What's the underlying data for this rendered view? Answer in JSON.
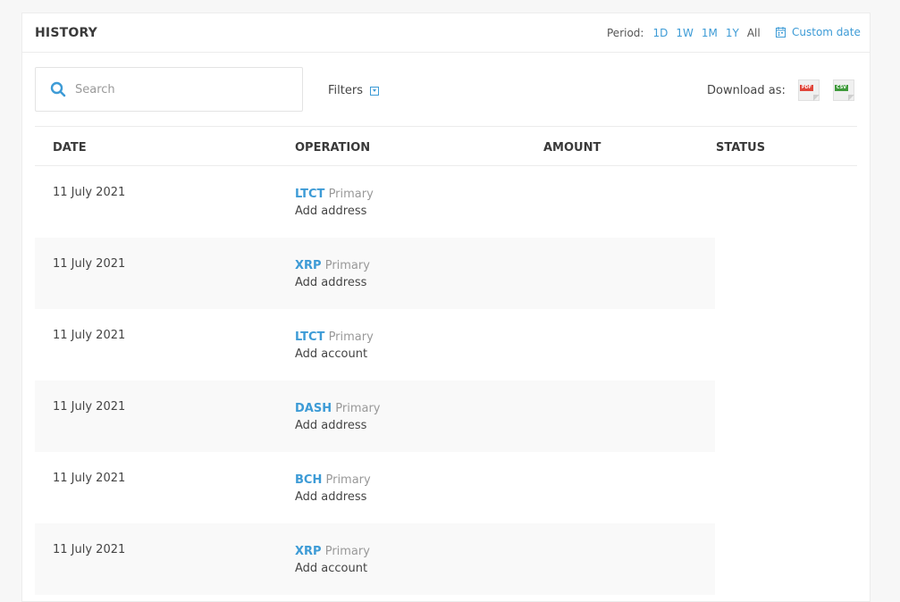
{
  "header": {
    "title": "HISTORY",
    "period_label": "Period:",
    "period_options": [
      "1D",
      "1W",
      "1M",
      "1Y",
      "All"
    ],
    "period_selected": "All",
    "custom_date": "Custom date"
  },
  "toolbar": {
    "search_placeholder": "Search",
    "filters_label": "Filters",
    "download_label": "Download as:",
    "formats": [
      "PDF",
      "CSV"
    ]
  },
  "table": {
    "columns": [
      "DATE",
      "OPERATION",
      "AMOUNT",
      "STATUS"
    ],
    "rows": [
      {
        "date": "11 July 2021",
        "coin": "LTCT",
        "account": "Primary",
        "operation": "Add address"
      },
      {
        "date": "11 July 2021",
        "coin": "XRP",
        "account": "Primary",
        "operation": "Add address"
      },
      {
        "date": "11 July 2021",
        "coin": "LTCT",
        "account": "Primary",
        "operation": "Add account"
      },
      {
        "date": "11 July 2021",
        "coin": "DASH",
        "account": "Primary",
        "operation": "Add address"
      },
      {
        "date": "11 July 2021",
        "coin": "BCH",
        "account": "Primary",
        "operation": "Add address"
      },
      {
        "date": "11 July 2021",
        "coin": "XRP",
        "account": "Primary",
        "operation": "Add account"
      }
    ]
  },
  "colors": {
    "accent": "#3d9bd6",
    "row_alt": "#f9f9f9"
  }
}
